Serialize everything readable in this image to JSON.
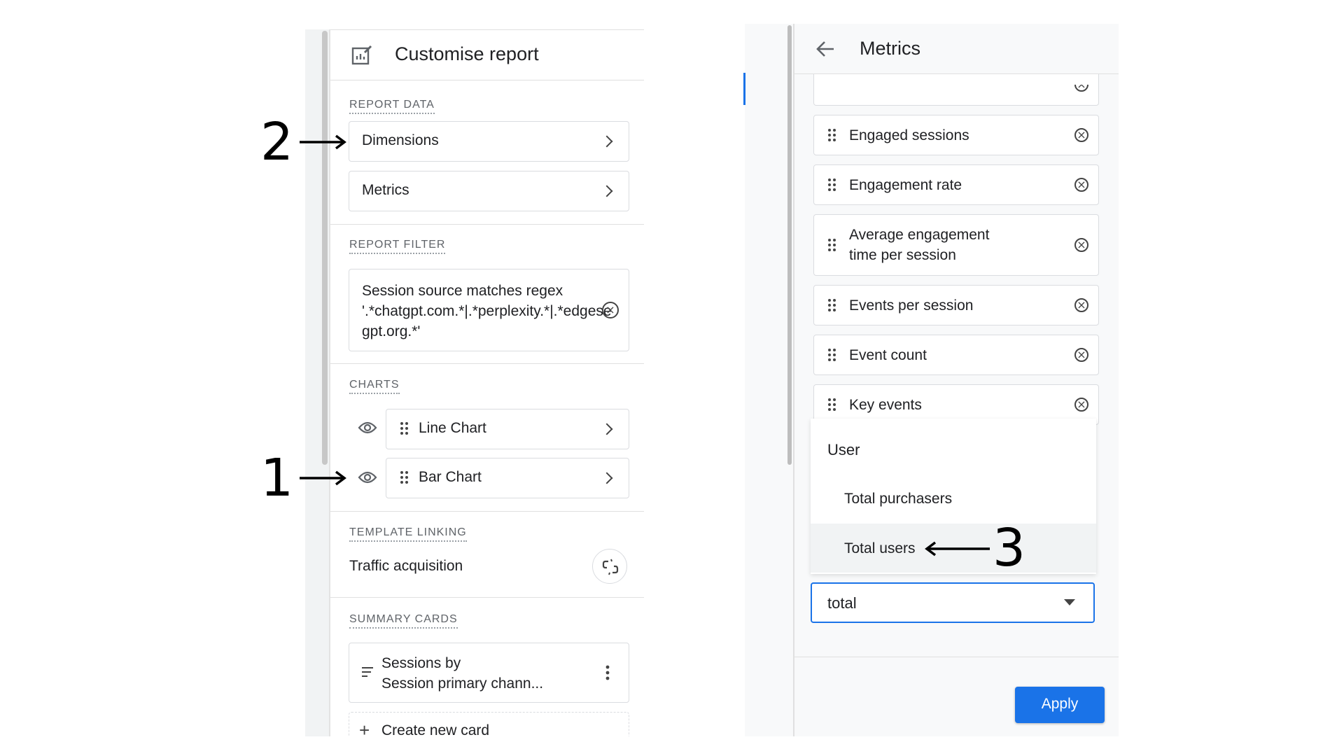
{
  "left": {
    "title": "Customise report",
    "sections": {
      "report_data": "REPORT DATA",
      "report_filter": "REPORT FILTER",
      "charts": "CHARTS",
      "template_linking": "TEMPLATE LINKING",
      "summary_cards": "SUMMARY CARDS"
    },
    "dimensions_label": "Dimensions",
    "metrics_label": "Metrics",
    "filter_text": "Session source matches regex '.*chatgpt.com.*|.*perplexity.*|.*edgeservices.bing.com.*|.*copilot.microsoft.com.*|.*gemini.google.com.*|.*gpt.org.*'",
    "filter_line1": "Session source matches regex",
    "filter_line2": "'.*chatgpt.com.*|.*perplexity.*|.*edgese",
    "filter_line3": "gpt.org.*'",
    "charts": [
      "Line Chart",
      "Bar Chart"
    ],
    "template_linking_value": "Traffic acquisition",
    "summary_card_line1": "Sessions by",
    "summary_card_line2": "Session primary chann...",
    "create_card": "Create new card"
  },
  "right": {
    "title": "Metrics",
    "metrics": [
      "Engaged sessions",
      "Engagement rate",
      "Average engagement time per session",
      "Events per session",
      "Event count",
      "Key events"
    ],
    "avg_line1": "Average engagement",
    "avg_line2": "time per session",
    "dropdown_group": "User",
    "dropdown_options": [
      "Total purchasers",
      "Total users"
    ],
    "search_value": "total",
    "apply_label": "Apply"
  },
  "annotations": [
    "2",
    "1",
    "3"
  ],
  "colors": {
    "accent": "#1a73e8",
    "hover": "#f1f3f4"
  }
}
